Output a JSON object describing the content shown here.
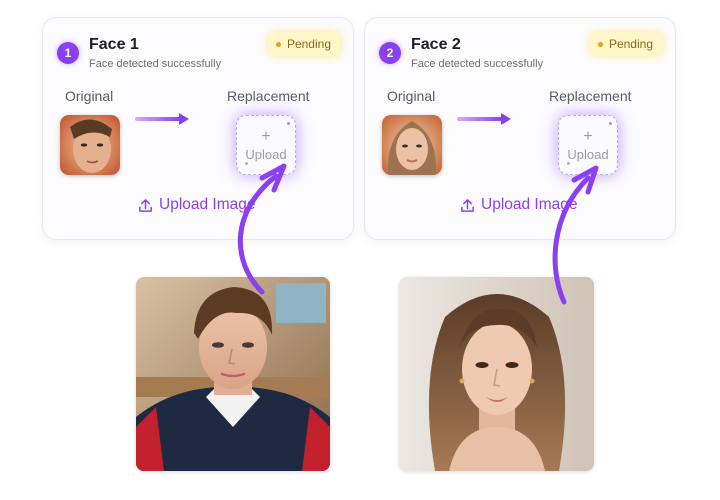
{
  "cards": [
    {
      "number": "1",
      "title": "Face 1",
      "subtitle": "Face detected successfully",
      "status": "Pending",
      "original_label": "Original",
      "replacement_label": "Replacement",
      "dropzone_plus": "+",
      "dropzone_text": "Upload",
      "upload_link": "Upload Image"
    },
    {
      "number": "2",
      "title": "Face 2",
      "subtitle": "Face detected successfully",
      "status": "Pending",
      "original_label": "Original",
      "replacement_label": "Replacement",
      "dropzone_plus": "+",
      "dropzone_text": "Upload",
      "upload_link": "Upload Image"
    }
  ],
  "colors": {
    "accent": "#8a3ff0",
    "pending_bg": "#fff6c9",
    "pending_dot": "#e0a21a",
    "card_border": "#e8e8ef"
  },
  "icons": [
    "upload-icon",
    "arrow-right-icon",
    "curved-arrow-icon"
  ]
}
